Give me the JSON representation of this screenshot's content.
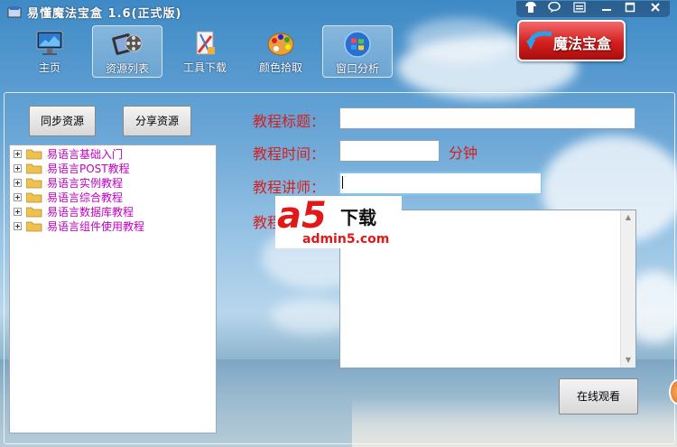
{
  "window": {
    "title": "易懂魔法宝盒 1.6(正式版)",
    "controls": [
      "shirt-icon",
      "chat-icon",
      "menu-icon",
      "minimize-icon",
      "maximize-icon",
      "close-icon"
    ]
  },
  "toolbar": {
    "items": [
      {
        "label": "主页",
        "icon": "monitor-icon"
      },
      {
        "label": "资源列表",
        "icon": "film-reel-icon",
        "active": true
      },
      {
        "label": "工具下载",
        "icon": "tools-icon"
      },
      {
        "label": "颜色拾取",
        "icon": "palette-icon"
      },
      {
        "label": "窗口分析",
        "icon": "windows-orb-icon",
        "active": true
      }
    ],
    "brand_button": {
      "label": "魔法宝盒"
    }
  },
  "left": {
    "sync_button": "同步资源",
    "share_button": "分享资源",
    "tree": [
      "易语言基础入门",
      "易语言POST教程",
      "易语言实例教程",
      "易语言综合教程",
      "易语言数据库教程",
      "易语言组件使用教程"
    ]
  },
  "form": {
    "title_label": "教程标题：",
    "title_value": "",
    "time_label": "教程时间：",
    "time_value": "",
    "time_unit": "分钟",
    "teacher_label": "教程讲师：",
    "teacher_value": "",
    "desc_label": "教程",
    "desc_value": "",
    "watch_button": "在线观看"
  },
  "watermark": {
    "brand": "a5",
    "suffix": "下载",
    "url": "admin5.com"
  }
}
